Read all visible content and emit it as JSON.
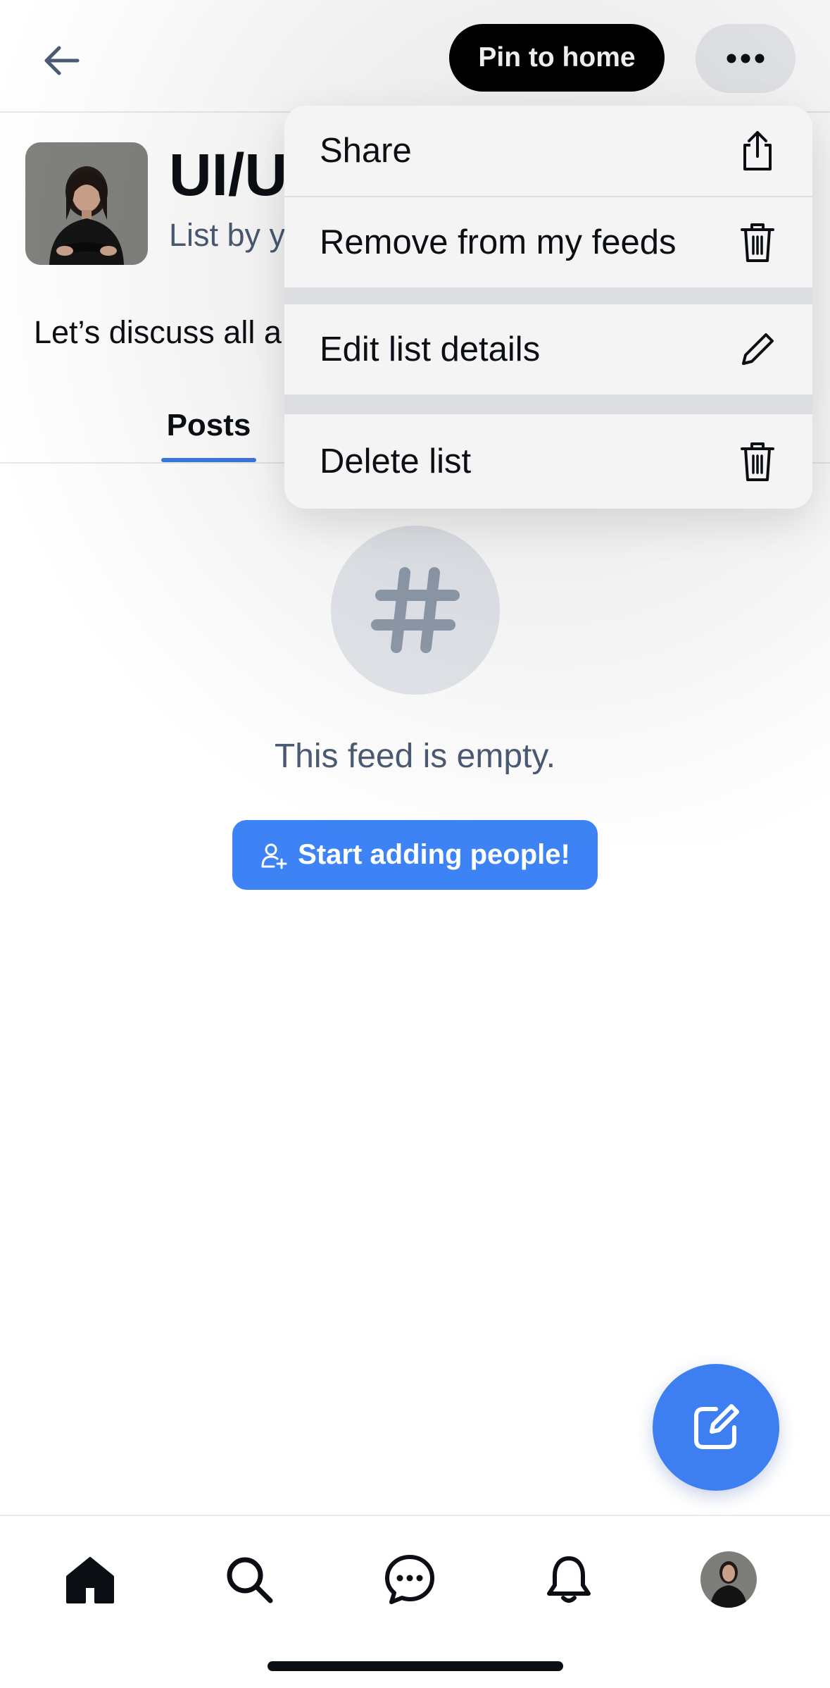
{
  "header": {
    "pin_label": "Pin to home"
  },
  "list": {
    "title": "UI/UX",
    "byline": "List by y",
    "description": "Let’s discuss all a"
  },
  "tabs": [
    {
      "label": "Posts",
      "active": true
    }
  ],
  "empty_state": {
    "message": "This feed is empty.",
    "button_label": "Start adding people!"
  },
  "menu": {
    "items": [
      {
        "label": "Share",
        "icon": "share-icon"
      },
      {
        "label": "Remove from my feeds",
        "icon": "trash-icon"
      },
      {
        "label": "Edit list details",
        "icon": "pencil-icon"
      },
      {
        "label": "Delete list",
        "icon": "trash-icon"
      }
    ]
  },
  "bottom_nav": [
    {
      "name": "home",
      "icon": "home-icon",
      "active": true
    },
    {
      "name": "search",
      "icon": "search-icon"
    },
    {
      "name": "chat",
      "icon": "chat-icon"
    },
    {
      "name": "notifications",
      "icon": "bell-icon"
    },
    {
      "name": "profile",
      "icon": "avatar"
    }
  ],
  "colors": {
    "accent": "#3d83f5",
    "tab_underline": "#3a7ae0",
    "text_primary": "#0b0f14",
    "text_secondary": "#4b5b73"
  }
}
